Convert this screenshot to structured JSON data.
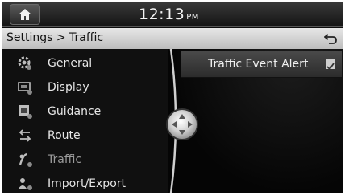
{
  "status": {
    "time": "12:13",
    "ampm": "PM"
  },
  "header": {
    "breadcrumb": "Settings > Traffic"
  },
  "menu": {
    "items": [
      {
        "label": "General",
        "icon": "gear-icon"
      },
      {
        "label": "Display",
        "icon": "display-icon"
      },
      {
        "label": "Guidance",
        "icon": "guidance-icon"
      },
      {
        "label": "Route",
        "icon": "route-icon"
      },
      {
        "label": "Traffic",
        "icon": "traffic-icon",
        "active": true
      },
      {
        "label": "Import/Export",
        "icon": "import-export-icon"
      }
    ]
  },
  "traffic": {
    "event_alert_label": "Traffic Event Alert",
    "event_alert_checked": true
  }
}
